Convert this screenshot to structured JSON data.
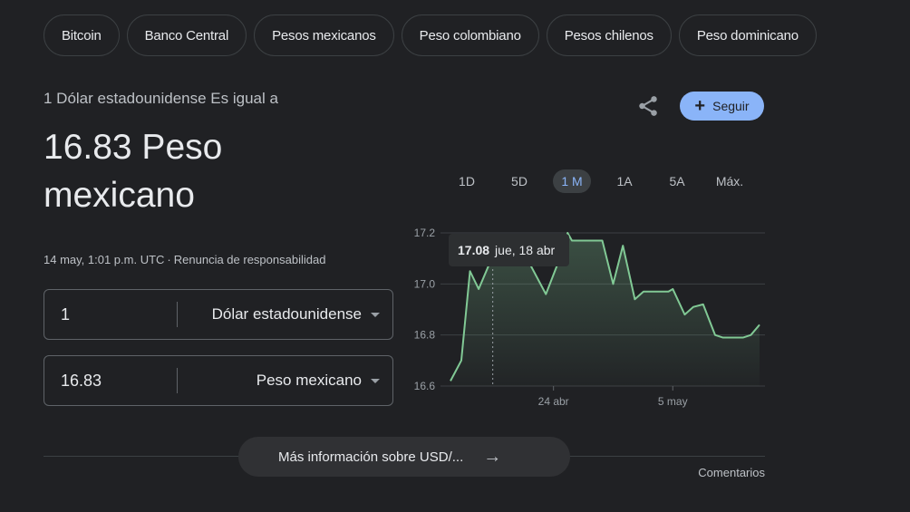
{
  "chips": [
    "Bitcoin",
    "Banco Central",
    "Pesos mexicanos",
    "Peso colombiano",
    "Pesos chilenos",
    "Peso dominicano"
  ],
  "converter": {
    "lead": "1 Dólar estadounidense Es igual a",
    "result_line1": "16.83 Peso",
    "result_line2": "mexicano",
    "timestamp": "14 may, 1:01 p.m. UTC",
    "separator": "·",
    "disclaimer": "Renuncia de responsabilidad",
    "from_amount": "1",
    "from_currency": "Dólar estadounidense",
    "to_amount": "16.83",
    "to_currency": "Peso mexicano"
  },
  "actions": {
    "share_icon": "share-icon",
    "follow_label": "Seguir",
    "follow_icon": "+"
  },
  "ranges": [
    "1D",
    "5D",
    "1 M",
    "1A",
    "5A",
    "Máx."
  ],
  "active_range": "1 M",
  "tooltip": {
    "value": "17.08",
    "date": "jue, 18 abr"
  },
  "footer": {
    "more_label": "Más información sobre USD/...",
    "more_arrow": "→",
    "feedback": "Comentarios"
  },
  "colors": {
    "accent": "#8ab4f8",
    "line": "#81c995",
    "background": "#202124"
  },
  "chart_data": {
    "type": "area",
    "title": "",
    "xlabel": "",
    "ylabel": "",
    "ylim": [
      16.6,
      17.2
    ],
    "yticks": [
      "17.2",
      "17.0",
      "16.8",
      "16.6"
    ],
    "ytick_values": [
      17.2,
      17.0,
      16.8,
      16.6
    ],
    "xticks": [
      "24 abr",
      "5 may"
    ],
    "xtick_days": [
      9.5,
      20.5
    ],
    "grid": true,
    "hover_day": 3.9,
    "points": [
      {
        "d": 0.0,
        "v": 16.62
      },
      {
        "d": 1.0,
        "v": 16.7
      },
      {
        "d": 1.8,
        "v": 17.05
      },
      {
        "d": 2.6,
        "v": 16.98
      },
      {
        "d": 3.6,
        "v": 17.08
      },
      {
        "d": 7.3,
        "v": 17.08
      },
      {
        "d": 8.8,
        "v": 16.96
      },
      {
        "d": 9.9,
        "v": 17.08
      },
      {
        "d": 10.8,
        "v": 17.2
      },
      {
        "d": 11.2,
        "v": 17.17
      },
      {
        "d": 14.0,
        "v": 17.17
      },
      {
        "d": 15.0,
        "v": 17.0
      },
      {
        "d": 15.9,
        "v": 17.15
      },
      {
        "d": 17.0,
        "v": 16.94
      },
      {
        "d": 17.8,
        "v": 16.97
      },
      {
        "d": 20.1,
        "v": 16.97
      },
      {
        "d": 20.5,
        "v": 16.98
      },
      {
        "d": 21.6,
        "v": 16.88
      },
      {
        "d": 22.4,
        "v": 16.91
      },
      {
        "d": 23.3,
        "v": 16.92
      },
      {
        "d": 24.4,
        "v": 16.8
      },
      {
        "d": 25.1,
        "v": 16.79
      },
      {
        "d": 27.0,
        "v": 16.79
      },
      {
        "d": 27.7,
        "v": 16.8
      },
      {
        "d": 28.5,
        "v": 16.84
      }
    ]
  }
}
